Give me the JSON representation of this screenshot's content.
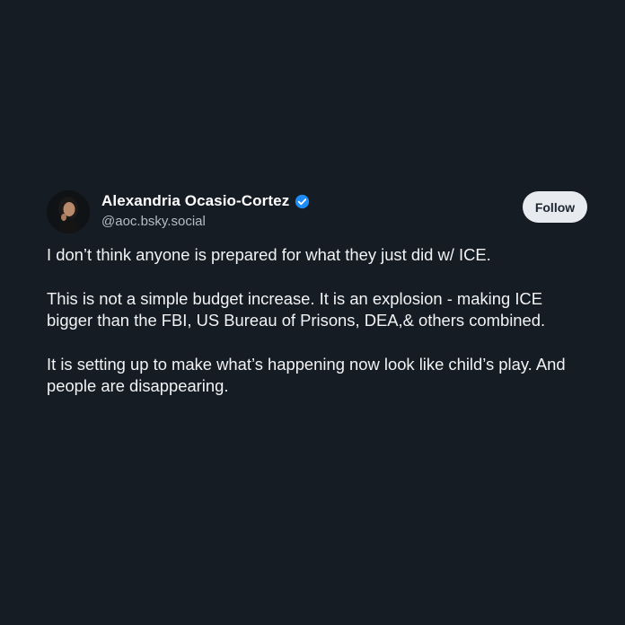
{
  "post": {
    "author": {
      "display_name": "Alexandria Ocasio-Cortez",
      "handle": "@aoc.bsky.social",
      "verified": true,
      "avatar_icon": "profile-photo",
      "verified_icon": "verified-check-icon"
    },
    "follow_label": "Follow",
    "paragraphs": [
      "I don’t think anyone is prepared for what they just did w/ ICE.",
      "This is not a simple budget increase. It is an explosion - making ICE bigger than the FBI, US Bureau of Prisons, DEA,& others combined.",
      "It is setting up to make what’s happening now look like child’s play. And people are disappearing."
    ]
  },
  "colors": {
    "background": "#161c24",
    "text": "#f1f3f5",
    "handle": "#b4bcc6",
    "verified_badge": "#1d8cf8",
    "follow_button_bg": "#e7eaee",
    "follow_button_text": "#1d2530"
  }
}
